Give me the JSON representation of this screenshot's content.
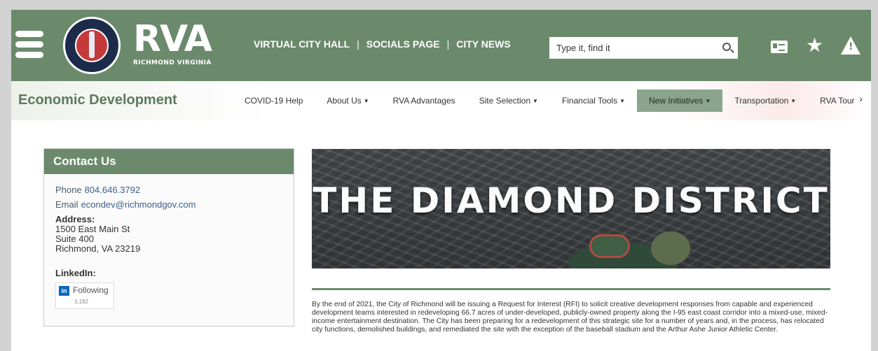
{
  "header": {
    "logo_main": "RVA",
    "logo_sub": "RICHMOND VIRGINIA",
    "links": [
      "VIRTUAL CITY HALL",
      "SOCIALS PAGE",
      "CITY NEWS"
    ],
    "separator": "|",
    "search_placeholder": "Type it, find it"
  },
  "subnav": {
    "dept": "Economic Development",
    "items": [
      "COVID-19 Help",
      "About Us",
      "RVA Advantages",
      "Site Selection",
      "Financial Tools",
      "New Initiatives",
      "Transportation",
      "RVA Tour"
    ],
    "active": "New Initiatives",
    "next_symbol": "›"
  },
  "contact": {
    "title": "Contact Us",
    "phone_label": "Phone",
    "phone": "804.646.3792",
    "email_label": "Email",
    "email": "econdev@richmondgov.com",
    "address_label": "Address:",
    "address": [
      "1500 East Main St",
      "Suite 400",
      "Richmond, VA 23219"
    ],
    "linkedin_label": "LinkedIn:",
    "linkedin_button": "Following",
    "linkedin_count": "1,182",
    "linkedin_mark": "in"
  },
  "hero": {
    "title": "THE DIAMOND DISTRICT"
  },
  "intro": "By the end of 2021, the City of Richmond will be issuing a Request for Interest (RFI) to solicit creative development responses from capable and experienced development teams interested in redeveloping 66.7 acres of under-developed, publicly-owned property along the I-95 east coast corridor into a mixed-use, mixed-income entertainment destination. The City has been preparing for a redevelopment of this strategic site for a number of years and, in the process, has relocated city functions, demolished buildings, and remediated the site with the exception of the baseball stadium and the Arthur Ashe Junior Athletic Center.",
  "icons": [
    "menu-icon",
    "city-seal-icon",
    "search-icon",
    "contact-card-icon",
    "star-icon",
    "alert-icon",
    "linkedin-icon"
  ],
  "colors": {
    "brand_green": "#6b8a6c",
    "link_blue": "#3e5f8c",
    "linkedin_blue": "#0a66c2"
  }
}
